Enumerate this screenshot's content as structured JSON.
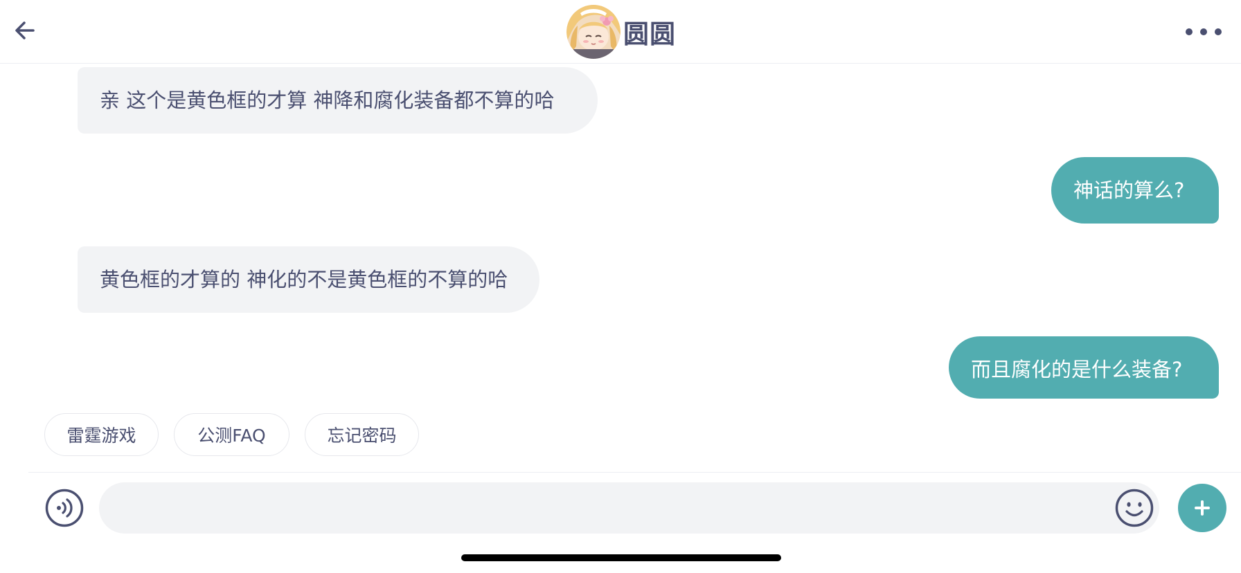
{
  "header": {
    "title": "圆圆",
    "back_icon": "arrow-left-icon",
    "more_icon": "more-horizontal-icon",
    "avatar": "anime-girl-avatar"
  },
  "messages": [
    {
      "side": "left",
      "text": "亲 这个是黄色框的才算   神降和腐化装备都不算的哈"
    },
    {
      "side": "right",
      "text": "神话的算么?"
    },
    {
      "side": "left",
      "text": "黄色框的才算的 神化的不是黄色框的不算的哈"
    },
    {
      "side": "right",
      "text": "而且腐化的是什么装备?"
    }
  ],
  "quick_replies": [
    {
      "label": "雷霆游戏"
    },
    {
      "label": "公测FAQ"
    },
    {
      "label": "忘记密码"
    }
  ],
  "input": {
    "value": "",
    "placeholder": "",
    "voice_icon": "voice-icon",
    "emoji_icon": "emoji-icon",
    "plus_icon": "plus-icon"
  },
  "colors": {
    "accent": "#52adb0",
    "text": "#4a4f70",
    "bubble_left": "#f2f3f5"
  }
}
